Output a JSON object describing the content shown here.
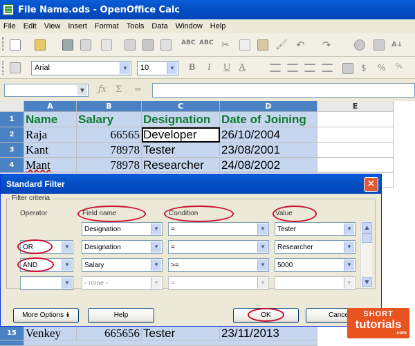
{
  "window": {
    "title": "File Name.ods - OpenOffice Calc"
  },
  "menu": [
    "File",
    "Edit",
    "View",
    "Insert",
    "Format",
    "Tools",
    "Data",
    "Window",
    "Help"
  ],
  "toolbar": {
    "font_name": "Arial",
    "font_size": "10"
  },
  "sheet": {
    "columns": [
      "A",
      "B",
      "C",
      "D",
      "E"
    ],
    "rows": [
      {
        "num": "1",
        "cells": [
          "Name",
          "Salary",
          "Designation",
          "Date of Joining"
        ]
      },
      {
        "num": "2",
        "cells": [
          "Raja",
          "66565",
          "Developer",
          "26/10/2004"
        ]
      },
      {
        "num": "3",
        "cells": [
          "Kant",
          "78978",
          "Tester",
          "23/08/2001"
        ]
      },
      {
        "num": "4",
        "cells": [
          "Mant",
          "78978",
          "Researcher",
          "24/08/2002"
        ]
      }
    ],
    "row15": {
      "num": "15",
      "cells": [
        "Venkey",
        "665656",
        "Tester",
        "23/11/2013"
      ]
    }
  },
  "dialog": {
    "title": "Standard Filter",
    "frame_label": "Filter criteria",
    "headers": {
      "operator": "Operator",
      "field": "Field name",
      "condition": "Condition",
      "value": "Value"
    },
    "rows": [
      {
        "operator": "",
        "field": "Designation",
        "condition": "=",
        "value": "Tester"
      },
      {
        "operator": "OR",
        "field": "Designation",
        "condition": "=",
        "value": "Researcher"
      },
      {
        "operator": "AND",
        "field": "Salary",
        "condition": ">=",
        "value": "5000"
      },
      {
        "operator": "",
        "field": "- none -",
        "condition": "=",
        "value": ""
      }
    ],
    "buttons": {
      "more_options": "More Options",
      "help": "Help",
      "ok": "OK",
      "cancel": "Cancel"
    }
  },
  "watermark": {
    "line1": "SHORT",
    "line2": "tutorials",
    "line3": ".com"
  },
  "colors": {
    "title_bar": "#0550c6",
    "header_text": "#0e7a2e",
    "selection": "#c6d6ef",
    "annotation": "#c8102e",
    "logo": "#e8531f"
  }
}
